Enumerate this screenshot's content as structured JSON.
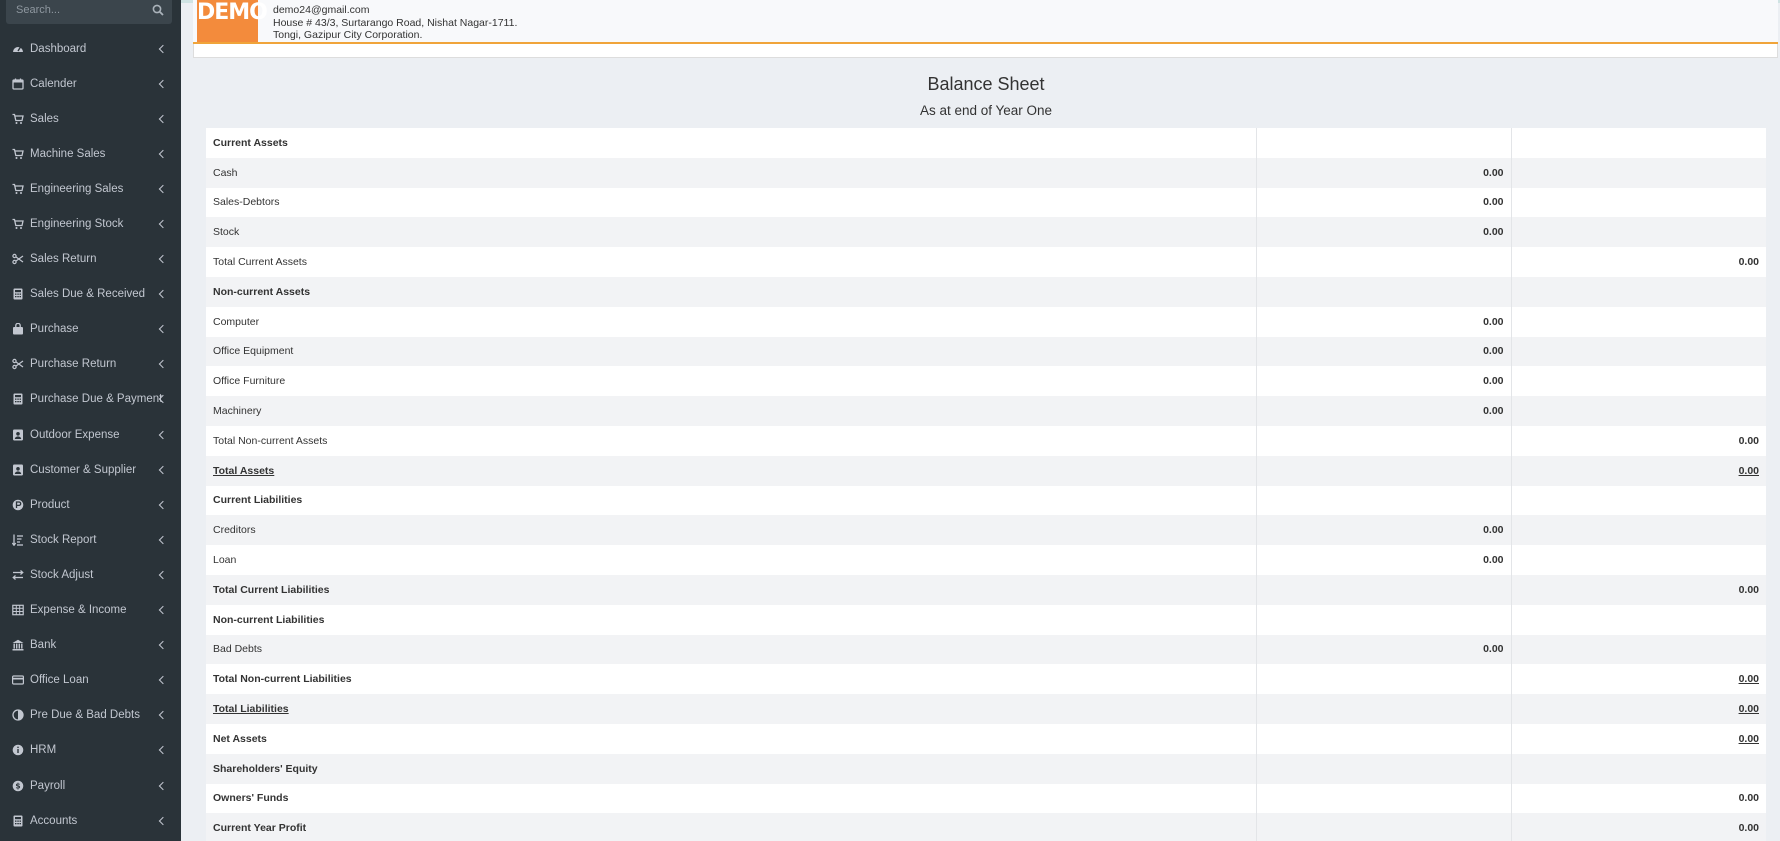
{
  "search": {
    "placeholder": "Search..."
  },
  "sidebar": {
    "items": [
      {
        "label": "Dashboard",
        "icon": "tachometer-icon"
      },
      {
        "label": "Calender",
        "icon": "calendar-icon"
      },
      {
        "label": "Sales",
        "icon": "cart-icon"
      },
      {
        "label": "Machine Sales",
        "icon": "cart-icon"
      },
      {
        "label": "Engineering Sales",
        "icon": "cart-icon"
      },
      {
        "label": "Engineering Stock",
        "icon": "cart-icon"
      },
      {
        "label": "Sales Return",
        "icon": "scissors-icon"
      },
      {
        "label": "Sales Due & Received",
        "icon": "calculator-icon"
      },
      {
        "label": "Purchase",
        "icon": "bag-icon"
      },
      {
        "label": "Purchase Return",
        "icon": "scissors-icon"
      },
      {
        "label": "Purchase Due & Payment",
        "icon": "calculator-icon"
      },
      {
        "label": "Outdoor Expense",
        "icon": "contact-card-icon"
      },
      {
        "label": "Customer & Supplier",
        "icon": "contact-card-icon"
      },
      {
        "label": "Product",
        "icon": "product-circle-icon"
      },
      {
        "label": "Stock Report",
        "icon": "sort-list-icon"
      },
      {
        "label": "Stock Adjust",
        "icon": "exchange-icon"
      },
      {
        "label": "Expense & Income",
        "icon": "table-icon"
      },
      {
        "label": "Bank",
        "icon": "bank-icon"
      },
      {
        "label": "Office Loan",
        "icon": "credit-card-icon"
      },
      {
        "label": "Pre Due & Bad Debts",
        "icon": "half-circle-icon"
      },
      {
        "label": "HRM",
        "icon": "info-circle-icon"
      },
      {
        "label": "Payroll",
        "icon": "dollar-circle-icon"
      },
      {
        "label": "Accounts",
        "icon": "calculator-icon"
      }
    ]
  },
  "company": {
    "logo_text": "DEMO",
    "email": "demo24@gmail.com",
    "address_line1": "House # 43/3, Surtarango Road, Nishat Nagar-1711.",
    "address_line2": "Tongi, Gazipur City Corporation."
  },
  "report": {
    "title": "Balance Sheet",
    "subtitle": "As at end of Year One",
    "rows": [
      {
        "label": "Current Assets",
        "col2": "",
        "col3": "",
        "style": "bold"
      },
      {
        "label": "Cash",
        "col2": "0.00",
        "col3": "",
        "style": "normal"
      },
      {
        "label": "Sales-Debtors",
        "col2": "0.00",
        "col3": "",
        "style": "normal"
      },
      {
        "label": "Stock",
        "col2": "0.00",
        "col3": "",
        "style": "normal"
      },
      {
        "label": "Total Current Assets",
        "col2": "",
        "col3": "0.00",
        "style": "normal"
      },
      {
        "label": "Non-current Assets",
        "col2": "",
        "col3": "",
        "style": "bold"
      },
      {
        "label": "Computer",
        "col2": "0.00",
        "col3": "",
        "style": "normal"
      },
      {
        "label": "Office Equipment",
        "col2": "0.00",
        "col3": "",
        "style": "normal"
      },
      {
        "label": "Office Furniture",
        "col2": "0.00",
        "col3": "",
        "style": "normal"
      },
      {
        "label": "Machinery",
        "col2": "0.00",
        "col3": "",
        "style": "normal"
      },
      {
        "label": "Total Non-current Assets",
        "col2": "",
        "col3": "0.00",
        "style": "normal"
      },
      {
        "label": "Total Assets",
        "col2": "",
        "col3": "0.00",
        "style": "underline"
      },
      {
        "label": "Current Liabilities",
        "col2": "",
        "col3": "",
        "style": "bold"
      },
      {
        "label": "Creditors",
        "col2": "0.00",
        "col3": "",
        "style": "normal"
      },
      {
        "label": "Loan",
        "col2": "0.00",
        "col3": "",
        "style": "normal"
      },
      {
        "label": "Total Current Liabilities",
        "col2": "",
        "col3": "0.00",
        "style": "bold"
      },
      {
        "label": "Non-current Liabilities",
        "col2": "",
        "col3": "",
        "style": "bold"
      },
      {
        "label": "Bad Debts",
        "col2": "0.00",
        "col3": "",
        "style": "normal"
      },
      {
        "label": "Total Non-current Liabilities",
        "col2": "",
        "col3": "0.00",
        "style": "bold-uval"
      },
      {
        "label": "Total Liabilities",
        "col2": "",
        "col3": "0.00",
        "style": "underline"
      },
      {
        "label": "Net Assets",
        "col2": "",
        "col3": "0.00",
        "style": "bold-uval"
      },
      {
        "label": "Shareholders' Equity",
        "col2": "",
        "col3": "",
        "style": "bold"
      },
      {
        "label": "Owners' Funds",
        "col2": "",
        "col3": "0.00",
        "style": "bold"
      },
      {
        "label": "Current Year Profit",
        "col2": "",
        "col3": "0.00",
        "style": "bold"
      }
    ]
  }
}
